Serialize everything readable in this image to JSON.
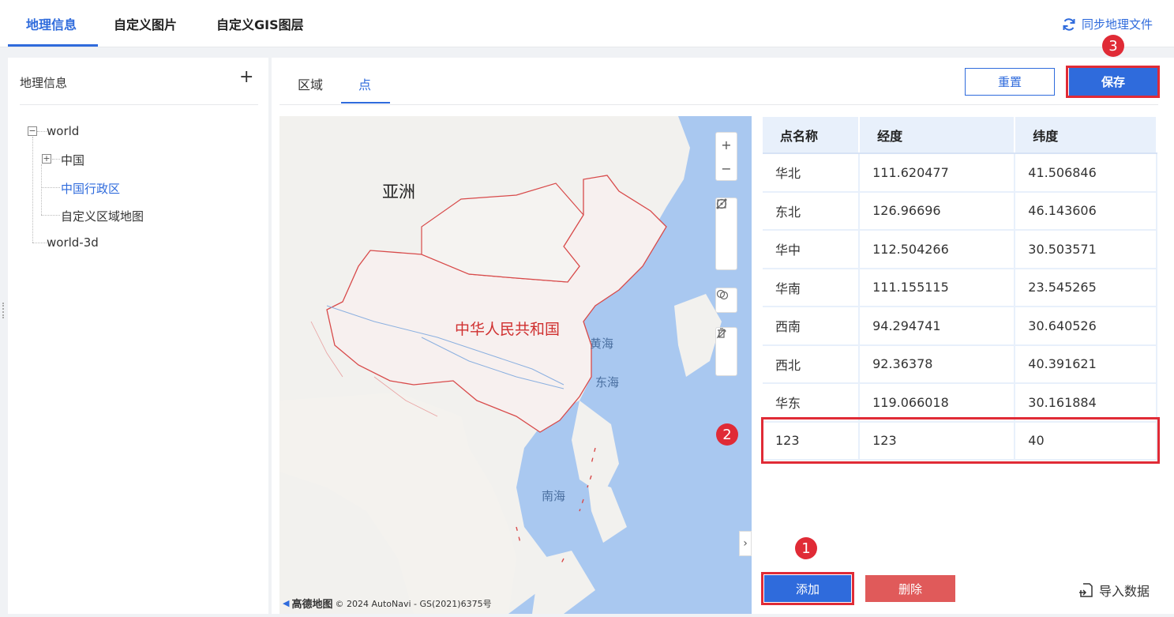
{
  "top_tabs": [
    {
      "label": "地理信息",
      "active": true
    },
    {
      "label": "自定义图片",
      "active": false
    },
    {
      "label": "自定义GIS图层",
      "active": false
    }
  ],
  "sync_label": "同步地理文件",
  "left_panel": {
    "title": "地理信息",
    "add_symbol": "+",
    "tree": {
      "root1": "world",
      "child_china": "中国",
      "child_admin": "中国行政区",
      "child_custom": "自定义区域地图",
      "root2": "world-3d"
    }
  },
  "sub_tabs": [
    {
      "label": "区域",
      "active": false
    },
    {
      "label": "点",
      "active": true
    }
  ],
  "buttons": {
    "reset": "重置",
    "save": "保存",
    "add": "添加",
    "delete": "删除",
    "import": "导入数据"
  },
  "map": {
    "labels": {
      "asia": "亚洲",
      "country": "中华人民共和国",
      "yellow_sea": "黄海",
      "east_sea": "东海",
      "south_sea": "南海"
    },
    "footer_brand": "高德地图",
    "footer_copyright": "© 2024 AutoNavi - GS(2021)6375号",
    "tools": [
      "zoom-in",
      "zoom-out",
      "draw-line",
      "draw-rect",
      "draw-point",
      "overlap",
      "edit",
      "delete"
    ]
  },
  "table": {
    "headers": [
      "点名称",
      "经度",
      "纬度"
    ],
    "rows": [
      [
        "华北",
        "111.620477",
        "41.506846"
      ],
      [
        "东北",
        "126.96696",
        "46.143606"
      ],
      [
        "华中",
        "112.504266",
        "30.503571"
      ],
      [
        "华南",
        "111.155115",
        "23.545265"
      ],
      [
        "西南",
        "94.294741",
        "30.640526"
      ],
      [
        "西北",
        "92.36378",
        "40.391621"
      ],
      [
        "华东",
        "119.066018",
        "30.161884"
      ],
      [
        "123",
        "123",
        "40"
      ]
    ]
  },
  "badges": [
    "1",
    "2",
    "3"
  ],
  "colors": {
    "accent": "#2f6bdc",
    "danger": "#e05a5a",
    "highlight": "#e02b36"
  }
}
